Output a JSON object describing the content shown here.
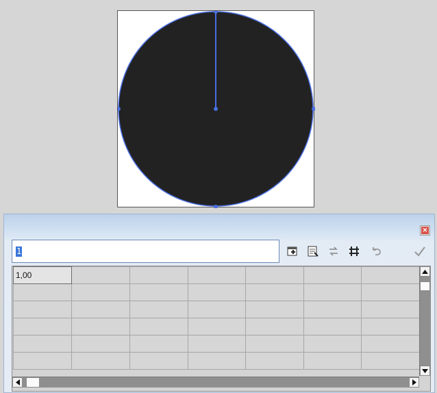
{
  "canvas": {
    "shape_fill": "#222222",
    "shape_stroke": "#4a6fe3",
    "artboard_color": "#ffffff"
  },
  "dialog": {
    "close_icon": "close-icon",
    "input": {
      "value": "1"
    },
    "toolbar": [
      {
        "name": "insert-row-icon"
      },
      {
        "name": "import-data-icon"
      },
      {
        "name": "switch-row-column-icon"
      },
      {
        "name": "cell-style-icon"
      },
      {
        "name": "revert-icon"
      },
      {
        "name": "apply-checkmark-icon"
      }
    ],
    "grid": {
      "first_cell": "1,00",
      "columns": 7,
      "rows": 6
    }
  }
}
